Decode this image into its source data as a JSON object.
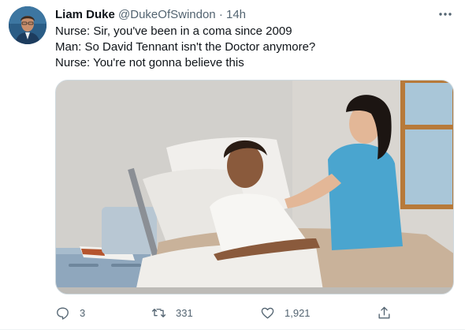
{
  "tweet": {
    "author_name": "Liam Duke",
    "handle": "@DukeOfSwindon",
    "separator": "·",
    "time": "14h",
    "lines": [
      "Nurse: Sir, you've been in a coma since 2009",
      "Man: So David Tennant isn't the Doctor anymore?",
      "Nurse: You're not gonna believe this"
    ]
  },
  "actions": {
    "reply_count": "3",
    "retweet_count": "331",
    "like_count": "1,921"
  },
  "icons": {
    "more": "more-horizontal-icon",
    "reply": "reply-icon",
    "retweet": "retweet-icon",
    "like": "heart-icon",
    "share": "share-icon"
  },
  "colors": {
    "text": "#0f1419",
    "secondary": "#536471",
    "border": "#cfd9de"
  }
}
